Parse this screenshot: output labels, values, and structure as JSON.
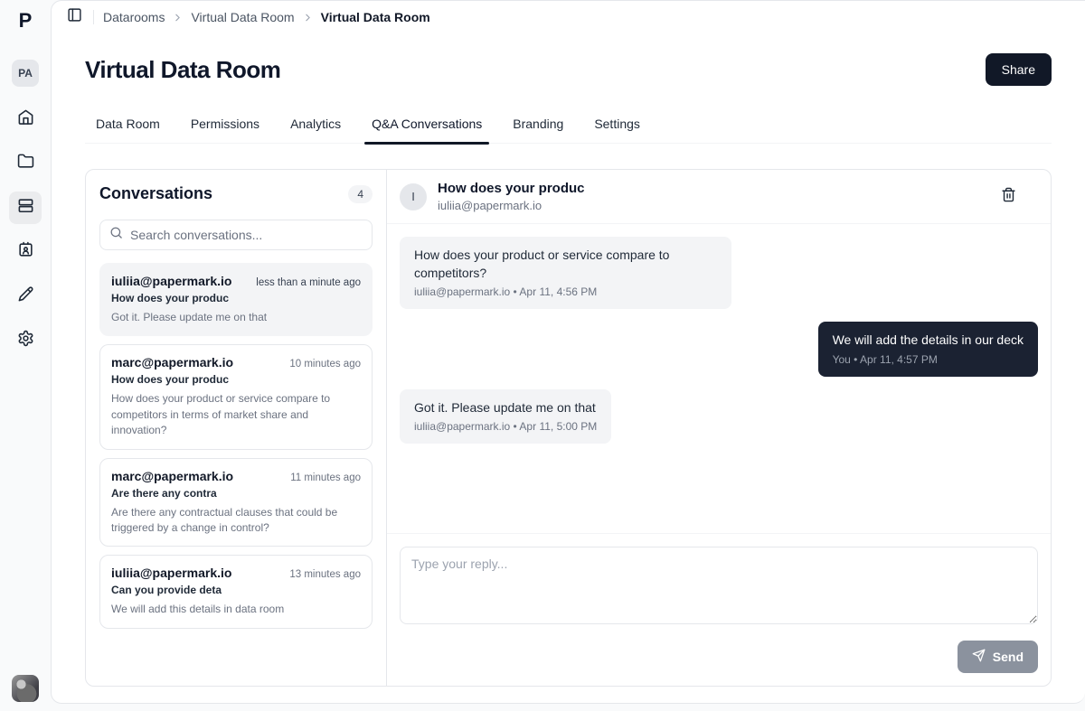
{
  "colors": {
    "accent_dark": "#111827",
    "bubble_dark": "#1b2232",
    "selected_item_bg": "#f3f4f6",
    "send_button_gray": "#8b929e",
    "page_bg": "#f9fafb"
  },
  "sidebar": {
    "logo": "P",
    "workspace_badge": "PA",
    "icons": [
      "home-icon",
      "folder-icon",
      "datarooms-icon (active)",
      "contacts-icon",
      "pen-icon",
      "settings-gear-icon"
    ],
    "active_item": "datarooms"
  },
  "topbar": {
    "breadcrumb": {
      "items": [
        {
          "label": "Datarooms"
        },
        {
          "label": "Virtual Data Room"
        },
        {
          "label": "Virtual Data Room"
        }
      ]
    }
  },
  "header": {
    "title": "Virtual Data Room",
    "share_label": "Share"
  },
  "tabs": {
    "items": [
      {
        "label": "Data Room",
        "active": false
      },
      {
        "label": "Permissions",
        "active": false
      },
      {
        "label": "Analytics",
        "active": false
      },
      {
        "label": "Q&A Conversations",
        "active": true
      },
      {
        "label": "Branding",
        "active": false
      },
      {
        "label": "Settings",
        "active": false
      }
    ]
  },
  "conversations": {
    "title": "Conversations",
    "count": "4",
    "search_placeholder": "Search conversations...",
    "items": [
      {
        "email": "iuliia@papermark.io",
        "time": "less than a minute ago",
        "title": "How does your produc",
        "preview": "Got it. Please update me on that",
        "selected": true
      },
      {
        "email": "marc@papermark.io",
        "time": "10 minutes ago",
        "title": "How does your produc",
        "preview": "How does your product or service compare to competitors in terms of market share and innovation?",
        "selected": false
      },
      {
        "email": "marc@papermark.io",
        "time": "11 minutes ago",
        "title": "Are there any contra",
        "preview": "Are there any contractual clauses that could be triggered by a change in control?",
        "selected": false
      },
      {
        "email": "iuliia@papermark.io",
        "time": "13 minutes ago",
        "title": "Can you provide deta",
        "preview": "We will add this details in data room",
        "selected": false
      }
    ]
  },
  "thread": {
    "avatar_letter": "I",
    "title": "How does your produc",
    "email": "iuliia@papermark.io",
    "messages": [
      {
        "side": "left",
        "text": "How does your product or service compare to competitors?",
        "meta": "iuliia@papermark.io • Apr 11, 4:56 PM"
      },
      {
        "side": "right",
        "text": "We will add the details in our deck",
        "meta": "You • Apr 11, 4:57 PM"
      },
      {
        "side": "left",
        "text": "Got it. Please update me on that",
        "meta": "iuliia@papermark.io • Apr 11, 5:00 PM"
      }
    ],
    "reply": {
      "placeholder": "Type your reply...",
      "send_label": "Send"
    }
  }
}
